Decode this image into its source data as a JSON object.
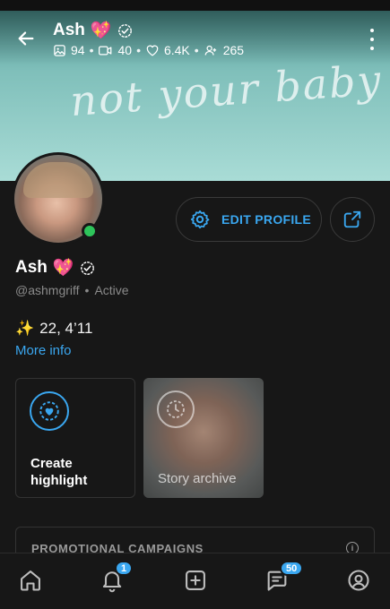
{
  "header": {
    "name": "Ash",
    "name_emoji": "💖",
    "stats": {
      "photos": "94",
      "videos": "40",
      "likes": "6.4K",
      "subscribers": "265",
      "separator": "•"
    }
  },
  "banner": {
    "script_text": "not your baby"
  },
  "profile": {
    "name": "Ash",
    "name_emoji": "💖",
    "handle": "@ashmgriff",
    "separator": "•",
    "status": "Active",
    "bio_emoji": "✨",
    "bio_text": "22, 4’11",
    "more_info": "More info"
  },
  "actions": {
    "edit_profile": "EDIT PROFILE"
  },
  "highlights": {
    "create_label_line1": "Create",
    "create_label_line2": "highlight",
    "archive_label": "Story archive"
  },
  "promo": {
    "title": "PROMOTIONAL CAMPAIGNS"
  },
  "nav": {
    "notifications_badge": "1",
    "messages_badge": "50"
  },
  "colors": {
    "accent": "#3aa7f0",
    "background": "#171717",
    "online": "#2ec45a",
    "banner": "#a9dcd6"
  },
  "icons": {
    "back": "arrow-left-icon",
    "verified": "verified-check-icon",
    "photos": "image-icon",
    "videos": "video-camera-icon",
    "likes": "heart-icon",
    "subscribers": "users-icon",
    "menu": "kebab-menu-icon",
    "settings": "gear-icon",
    "share": "share-icon",
    "highlight": "highlight-heart-icon",
    "archive": "clock-history-icon",
    "info": "info-icon",
    "home": "home-icon",
    "notifications": "bell-icon",
    "add": "plus-square-icon",
    "messages": "chat-icon",
    "profile": "profile-circle-icon"
  }
}
